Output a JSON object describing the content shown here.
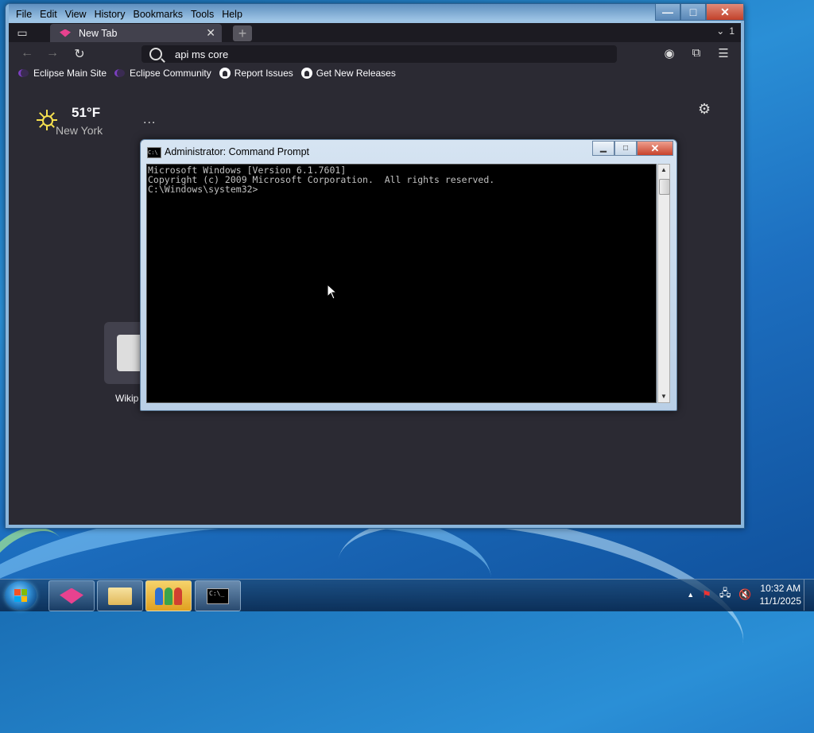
{
  "browser": {
    "menu": [
      "File",
      "Edit",
      "View",
      "History",
      "Bookmarks",
      "Tools",
      "Help"
    ],
    "window_buttons": {
      "minimize": "—",
      "maximize": "□",
      "close": "✕"
    },
    "tab": {
      "title": "New Tab",
      "close": "✕"
    },
    "new_tab": "+",
    "tab_count": "1",
    "url": "api ms core",
    "bookmarks": [
      {
        "label": "Eclipse Main Site",
        "icon": "eclipse-icon"
      },
      {
        "label": "Eclipse Community",
        "icon": "eclipse-icon"
      },
      {
        "label": "Report Issues",
        "icon": "github-icon"
      },
      {
        "label": "Get New Releases",
        "icon": "github-icon"
      }
    ],
    "weather": {
      "temp": "51°F",
      "city": "New York"
    },
    "more": "...",
    "shortcut_label": "Wikip"
  },
  "cmd": {
    "title": "Administrator: Command Prompt",
    "lines": [
      "Microsoft Windows [Version 6.1.7601]",
      "Copyright (c) 2009 Microsoft Corporation.  All rights reserved.",
      "",
      "C:\\Windows\\system32>"
    ]
  },
  "taskbar": {
    "time": "10:32 AM",
    "date": "11/1/2025"
  },
  "colors": {
    "browser_bg": "#2b2a33",
    "accent_pink": "#e8428f",
    "cmd_bg": "#000000",
    "cmd_text": "#c0c0c0"
  }
}
